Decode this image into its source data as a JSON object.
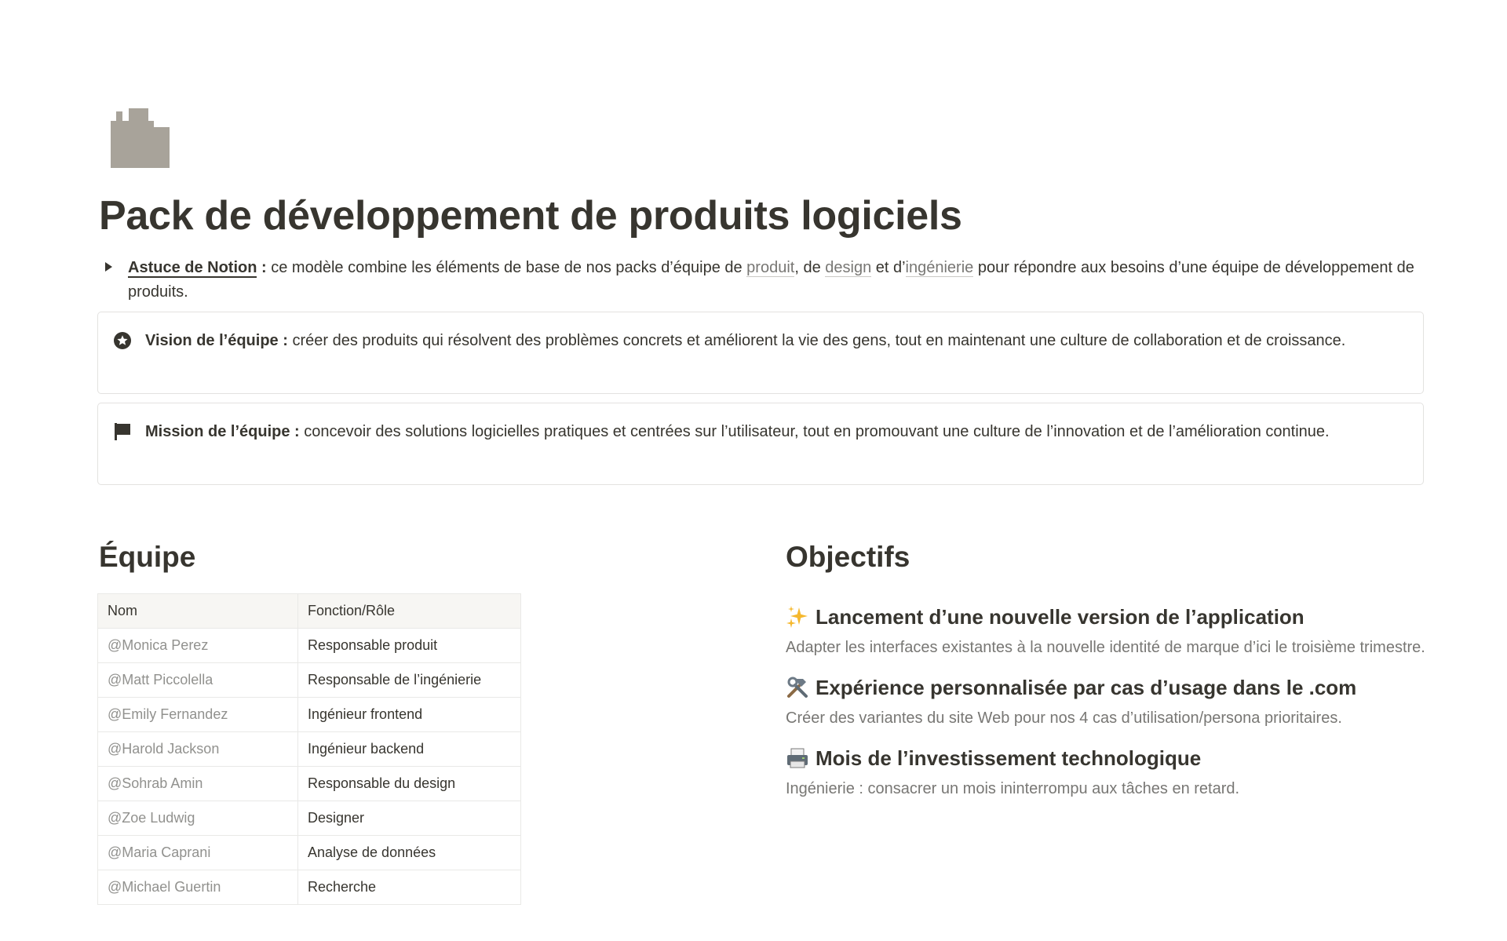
{
  "page": {
    "icon": "building-icon",
    "title": "Pack de développement de produits logiciels"
  },
  "tip": {
    "label": "Astuce de Notion",
    "separator": " : ",
    "text_before": "ce modèle combine les éléments de base de nos packs d’équipe de ",
    "link_produit": "produit",
    "mid1": ", de ",
    "link_design": "design",
    "mid2": " et d’",
    "link_ingenierie": "ingénierie",
    "text_after": " pour répondre aux besoins d’une équipe de développement de produits."
  },
  "vision": {
    "icon": "star-circle-icon",
    "label": "Vision de l’équipe :",
    "text": " créer des produits qui résolvent des problèmes concrets et améliorent la vie des gens, tout en maintenant une culture de collaboration et de croissance."
  },
  "mission": {
    "icon": "flag-icon",
    "label": "Mission de l’équipe :",
    "text": " concevoir des solutions logicielles pratiques et centrées sur l’utilisateur, tout en promouvant une culture de l’innovation et de l’amélioration continue."
  },
  "team": {
    "heading": "Équipe",
    "columns": [
      "Nom",
      "Fonction/Rôle"
    ],
    "rows": [
      {
        "name": "@Monica Perez",
        "role": "Responsable produit"
      },
      {
        "name": "@Matt Piccolella",
        "role": "Responsable de l’ingénierie"
      },
      {
        "name": "@Emily Fernandez",
        "role": "Ingénieur frontend"
      },
      {
        "name": "@Harold Jackson",
        "role": "Ingénieur backend"
      },
      {
        "name": "@Sohrab Amin",
        "role": "Responsable du design"
      },
      {
        "name": "@Zoe Ludwig",
        "role": "Designer"
      },
      {
        "name": "@Maria Caprani",
        "role": "Analyse de données"
      },
      {
        "name": "@Michael Guertin",
        "role": "Recherche"
      }
    ]
  },
  "goals": {
    "heading": "Objectifs",
    "items": [
      {
        "icon": "sparkles-icon",
        "title": "Lancement d’une nouvelle version de l’application",
        "desc": "Adapter les interfaces existantes à la nouvelle identité de marque d’ici le troisième trimestre."
      },
      {
        "icon": "tools-icon",
        "title": "Expérience personnalisée par cas d’usage dans le .com",
        "desc": "Créer des variantes du site Web pour nos 4 cas d’utilisation/persona prioritaires."
      },
      {
        "icon": "printer-icon",
        "title": "Mois de l’investissement technologique",
        "desc": "Ingénierie : consacrer un mois ininterrompu aux tâches en retard."
      }
    ]
  },
  "colors": {
    "text": "#37352f",
    "muted": "#787774",
    "border": "#e3e2e0",
    "icon_gray": "#a8a39a"
  }
}
